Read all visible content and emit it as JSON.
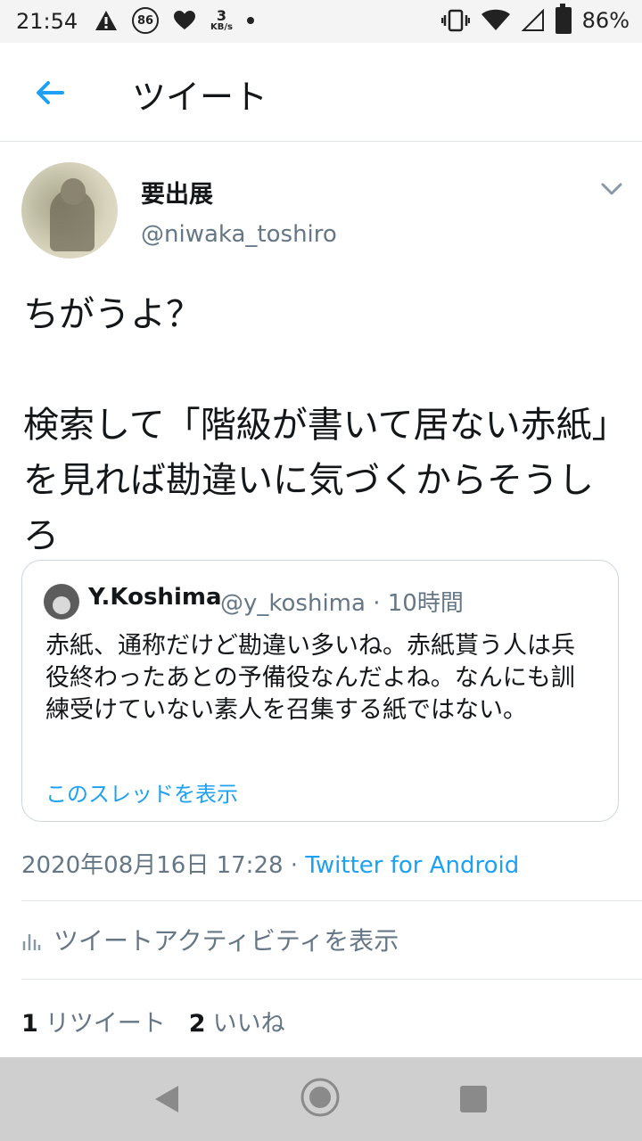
{
  "status_bar": {
    "time": "21:54",
    "notification_count": "86",
    "net_speed_value": "3",
    "net_speed_unit": "KB/s",
    "battery": "86%"
  },
  "header": {
    "title": "ツイート"
  },
  "tweet": {
    "display_name": "要出展",
    "handle": "@niwaka_toshiro",
    "text": "ちがうよ？\n\n検索して「階級が書いて居ない赤紙」を見れば勘違いに気づくからそうしろ",
    "timestamp": "2020年08月16日 17:28",
    "meta_separator": " · ",
    "source": "Twitter for Android"
  },
  "quoted": {
    "name": "Y.Koshima",
    "handle": "@y_koshima",
    "time": "10時間",
    "text": "赤紙、通称だけど勘違い多いね。赤紙貰う人は兵役終わったあとの予備役なんだよね。なんにも訓練受けていない素人を召集する紙ではない。",
    "show_thread": "このスレッドを表示"
  },
  "activity": {
    "label": "ツイートアクティビティを表示"
  },
  "stats": {
    "retweets": "1",
    "retweets_label": "リツイート",
    "likes": "2",
    "likes_label": "いいね"
  },
  "colors": {
    "accent": "#1da1f2",
    "secondary_text": "#657786",
    "primary_text": "#14171a",
    "divider": "#e1e8ed"
  }
}
